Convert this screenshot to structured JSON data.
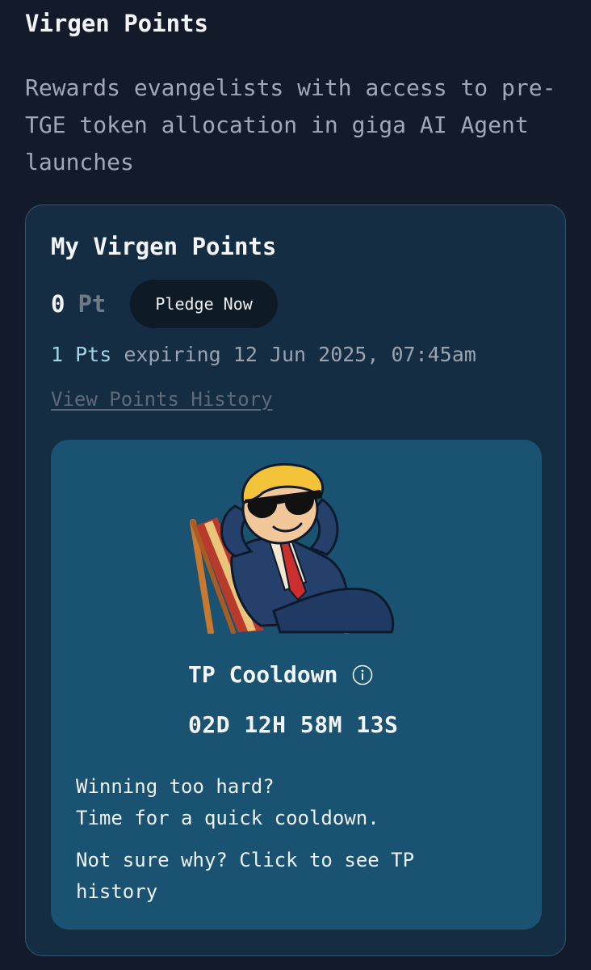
{
  "header": {
    "title": "Virgen Points",
    "description": "Rewards evangelists with access to pre-TGE token allocation in giga AI Agent launches"
  },
  "points_card": {
    "title": "My Virgen Points",
    "points_value": "0",
    "points_unit": "Pt",
    "pledge_label": "Pledge Now",
    "expiry_amount": "1 Pts",
    "expiry_text": "expiring 12 Jun 2025, 07:45am",
    "history_link": "View Points History"
  },
  "cooldown": {
    "illustration_icon": "relaxed-man-in-beach-chair-illustration",
    "title": "TP Cooldown",
    "info_icon": "info-icon",
    "countdown": "02D 12H 58M 13S",
    "message_line1": "Winning too hard?",
    "message_line2": "Time for a quick cooldown.",
    "history_prompt": "Not sure why? Click to see TP history"
  },
  "colors": {
    "background": "#131a29",
    "card": "#152d42",
    "inner_card": "#1a5372",
    "accent_text": "#9fd3e8"
  }
}
